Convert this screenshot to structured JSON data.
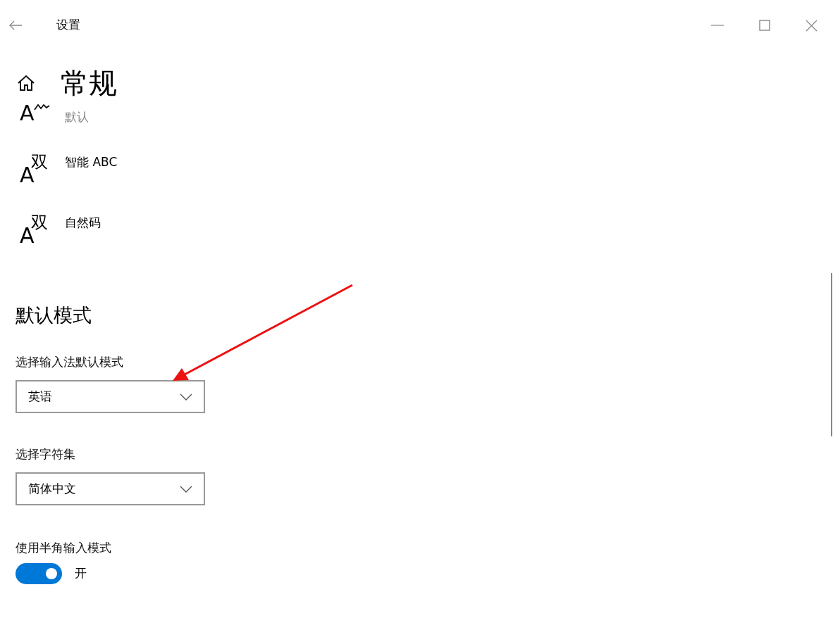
{
  "window": {
    "title": "设置"
  },
  "page": {
    "title": "常规"
  },
  "input_methods": [
    {
      "kind": "wave",
      "glyph": "A",
      "label": "默认",
      "dimmed": true
    },
    {
      "kind": "double",
      "glyph": "A",
      "mark": "双",
      "label": "智能 ABC",
      "dimmed": false
    },
    {
      "kind": "double",
      "glyph": "A",
      "mark": "双",
      "label": "自然码",
      "dimmed": false
    }
  ],
  "section": {
    "title": "默认模式"
  },
  "dropdowns": [
    {
      "label": "选择输入法默认模式",
      "value": "英语"
    },
    {
      "label": "选择字符集",
      "value": "简体中文"
    }
  ],
  "toggle": {
    "label": "使用半角输入模式",
    "on": true,
    "state_text": "开"
  }
}
